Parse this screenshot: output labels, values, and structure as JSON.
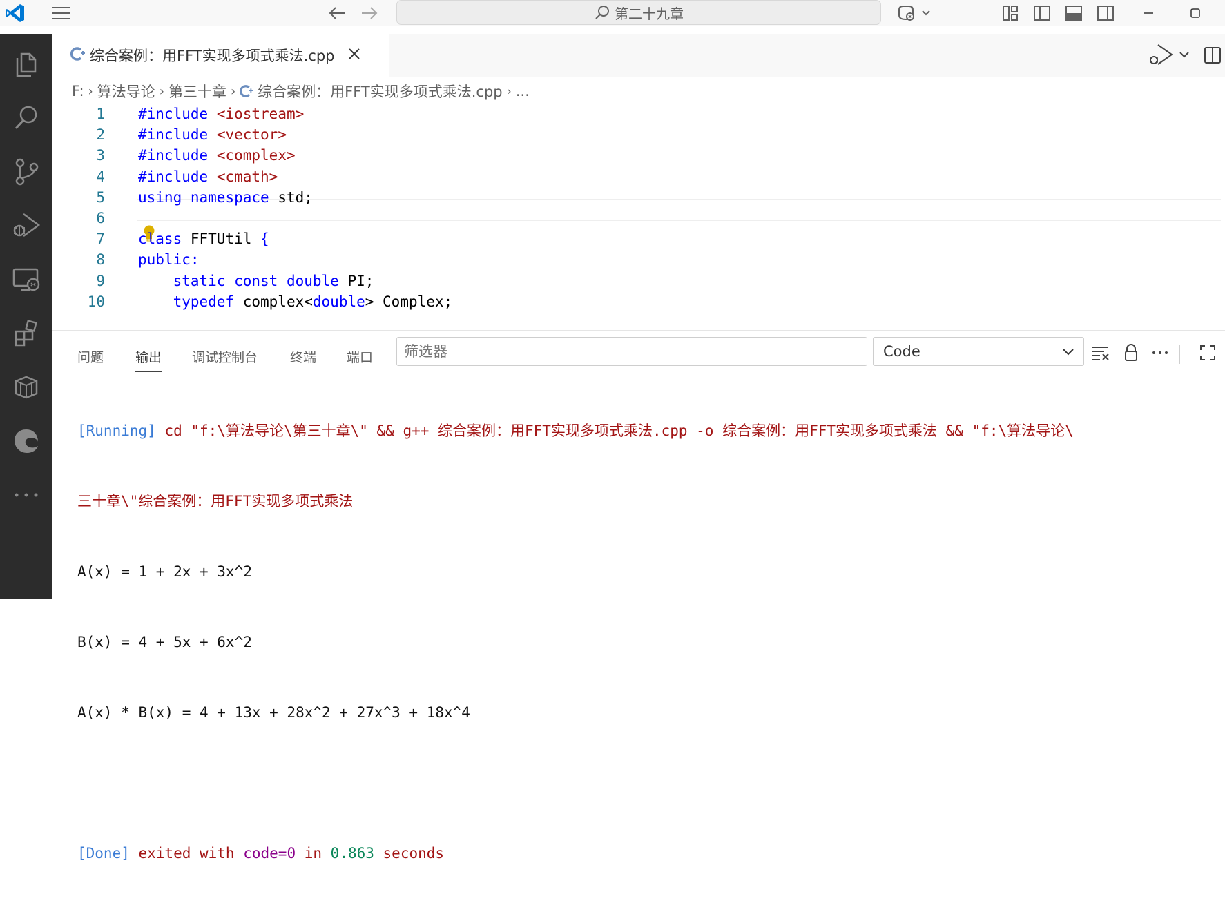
{
  "titlebar": {
    "search_text": "第二十九章"
  },
  "tab": {
    "label": "综合案例：用FFT实现多项式乘法.cpp"
  },
  "breadcrumb": {
    "items": [
      "F:",
      "算法导论",
      "第三十章",
      "综合案例：用FFT实现多项式乘法.cpp",
      "..."
    ]
  },
  "editor": {
    "lines": [
      {
        "num": "1",
        "tokens": [
          [
            "pp",
            "#include"
          ],
          [
            "",
            " "
          ],
          [
            "str",
            "<iostream>"
          ]
        ]
      },
      {
        "num": "2",
        "tokens": [
          [
            "pp",
            "#include"
          ],
          [
            "",
            " "
          ],
          [
            "str",
            "<vector>"
          ]
        ]
      },
      {
        "num": "3",
        "tokens": [
          [
            "pp",
            "#include"
          ],
          [
            "",
            " "
          ],
          [
            "str",
            "<complex>"
          ]
        ]
      },
      {
        "num": "4",
        "tokens": [
          [
            "pp",
            "#include"
          ],
          [
            "",
            " "
          ],
          [
            "str",
            "<cmath>"
          ]
        ]
      },
      {
        "num": "5",
        "tokens": [
          [
            "kw",
            "using"
          ],
          [
            "",
            " "
          ],
          [
            "kw",
            "namespace"
          ],
          [
            "",
            " std;"
          ]
        ]
      },
      {
        "num": "6",
        "tokens": []
      },
      {
        "num": "7",
        "tokens": [
          [
            "kw",
            "class"
          ],
          [
            "",
            " FFTUtil "
          ],
          [
            "kw",
            "{"
          ]
        ]
      },
      {
        "num": "8",
        "tokens": [
          [
            "kw",
            "public"
          ],
          [
            "kw",
            ":"
          ]
        ]
      },
      {
        "num": "9",
        "tokens": [
          [
            "",
            "    "
          ],
          [
            "kw",
            "static"
          ],
          [
            "",
            " "
          ],
          [
            "kw",
            "const"
          ],
          [
            "",
            " "
          ],
          [
            "kw",
            "double"
          ],
          [
            "",
            " PI;"
          ]
        ]
      },
      {
        "num": "10",
        "tokens": [
          [
            "",
            "    "
          ],
          [
            "kw",
            "typedef"
          ],
          [
            "",
            " complex<"
          ],
          [
            "kw",
            "double"
          ],
          [
            "",
            "> Complex;"
          ]
        ]
      }
    ]
  },
  "panel": {
    "tabs": [
      "问题",
      "输出",
      "调试控制台",
      "终端",
      "端口"
    ],
    "active_tab": "输出",
    "filter_placeholder": "筛选器",
    "channel": "Code",
    "output": {
      "running_tag": "[Running]",
      "running_cmd_1": " cd \"f:\\算法导论\\第三十章\\\" && g++ 综合案例：用FFT实现多项式乘法.cpp -o 综合案例：用FFT实现多项式乘法 && \"f:\\算法导论\\",
      "running_cmd_2": "三十章\\\"综合案例：用FFT实现多项式乘法",
      "line_a": "A(x) = 1 + 2x + 3x^2",
      "line_b": "B(x) = 4 + 5x + 6x^2",
      "line_ab": "A(x) * B(x) = 4 + 13x + 28x^2 + 27x^3 + 18x^4",
      "done_tag": "[Done]",
      "done_exited": " exited with ",
      "done_code": "code=0",
      "done_in": " in ",
      "done_time": "0.863",
      "done_seconds": " seconds"
    }
  },
  "colors": {
    "activitybar": "#2c2c2c",
    "accent": "#0078d4"
  }
}
